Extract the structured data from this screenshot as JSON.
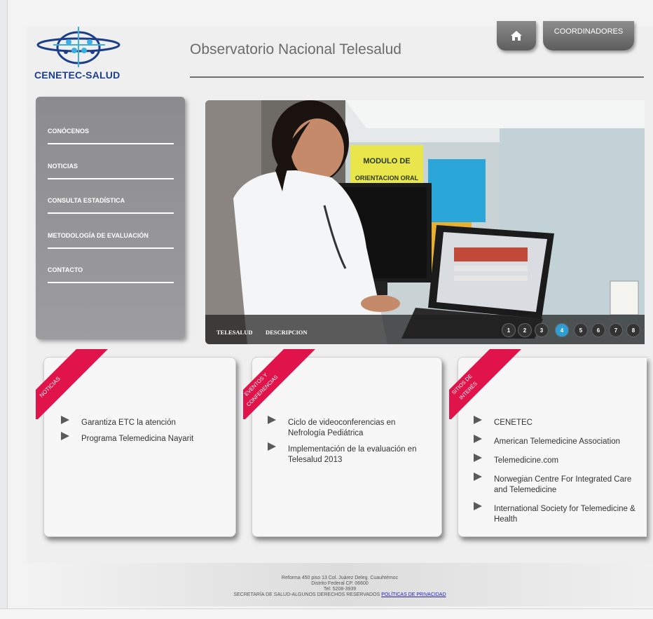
{
  "header": {
    "logo_text": "CENETEC-SALUD",
    "site_title": "Observatorio Nacional Telesalud",
    "coordinators_label": "COORDINADORES"
  },
  "sidebar": {
    "items": [
      {
        "label": "CONÓCENOS"
      },
      {
        "label": "NOTICIAS"
      },
      {
        "label": "CONSULTA ESTADÍSTICA"
      },
      {
        "label": "METODOLOGÍA DE EVALUACIÓN"
      },
      {
        "label": "CONTACTO"
      }
    ]
  },
  "hero": {
    "poster_line1": "MODULO DE",
    "poster_line2": "ORIENTACION ORAL",
    "links": [
      "TELESALUD",
      "DESCRIPCION"
    ],
    "pages": [
      "1",
      "2",
      "3",
      "4",
      "5",
      "6",
      "7",
      "8"
    ],
    "active_page": "4"
  },
  "cards": [
    {
      "ribbon_lines": [
        "NOTICIAS"
      ],
      "items": [
        "Garantiza ETC la atención",
        "Programa Telemedicina Nayarit"
      ]
    },
    {
      "ribbon_lines": [
        "EVENTOS Y",
        "CONFERENCIAS"
      ],
      "items": [
        "Ciclo de videoconferencias en Nefrología Pediátrica",
        "Implementación de la evaluación en Telesalud 2013"
      ]
    },
    {
      "ribbon_lines": [
        "SITIOS DE",
        "INTERÉS"
      ],
      "items": [
        "CENETEC",
        "American Telemedicine Association",
        "Telemedicine.com",
        "Norwegian Centre For Integrated Care and Telemedicine",
        "International Society for Telemedicine & Health"
      ]
    }
  ],
  "footer": {
    "line1": "Reforma 450 piso 13 Col. Juárez Deleg. Cuauhtémoc",
    "line2": "Distrito Federal CP. 06600",
    "line3": "Tel: 5208-3939",
    "line4": "SECRETARÍA DE SALUD-ALGUNOS DERECHOS RESERVADOS",
    "privacy_link": "POLÍTICAS DE PRIVACIDAD"
  },
  "colors": {
    "ribbon": "#e0134a",
    "menu": "#949496",
    "title": "#6b6b6b",
    "logo": "#1d3f8a",
    "active_dot": "#2e9fd4"
  },
  "icons": {
    "home": "home-icon",
    "bullet": "triangle-bullet-icon",
    "logo": "cenetec-logo-icon"
  }
}
